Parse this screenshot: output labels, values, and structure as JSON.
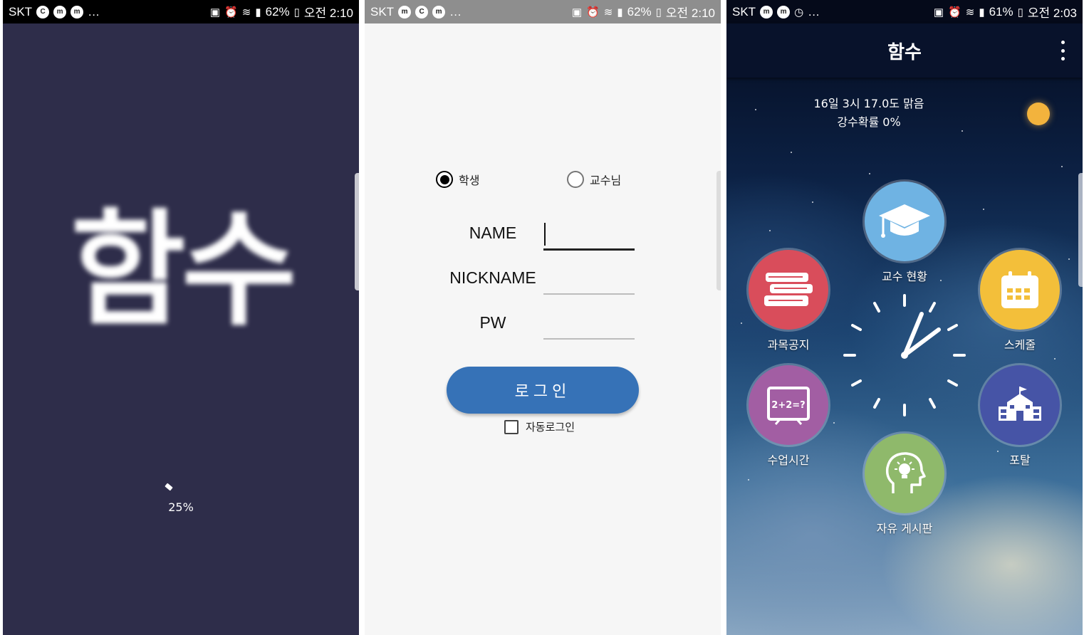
{
  "status_bars": [
    {
      "carrier": "SKT",
      "battery": "62%",
      "time": "오전 2:10"
    },
    {
      "carrier": "SKT",
      "battery": "62%",
      "time": "오전 2:10"
    },
    {
      "carrier": "SKT",
      "battery": "61%",
      "time": "오전 2:03"
    }
  ],
  "splash": {
    "logo_text": "함수",
    "progress_text": "25%",
    "background": "#2e2d4a"
  },
  "login": {
    "role_student": "학생",
    "role_professor": "교수님",
    "selected_role": "학생",
    "name_label": "NAME",
    "nickname_label": "NICKNAME",
    "pw_label": "PW",
    "login_button": "로그인",
    "auto_login_label": "자동로그인",
    "accent": "#3672b7"
  },
  "main": {
    "title": "함수",
    "weather_line1": "16일 3시 17.0도 맑음",
    "weather_line2": "강수확률 0%",
    "menu": {
      "professor_status": {
        "label": "교수 현황",
        "icon": "graduation-cap-icon",
        "color": "#6fb3e3"
      },
      "course_notice": {
        "label": "과목공지",
        "icon": "books-icon",
        "color": "#d94d5b"
      },
      "schedule": {
        "label": "스케줄",
        "icon": "calendar-icon",
        "color": "#f3bf3a"
      },
      "class_time": {
        "label": "수업시간",
        "icon": "chalkboard-icon",
        "color": "#a25ea3"
      },
      "portal": {
        "label": "포탈",
        "icon": "school-building-icon",
        "color": "#4654a6"
      },
      "free_board": {
        "label": "자유 게시판",
        "icon": "head-idea-icon",
        "color": "#8fb96b"
      }
    }
  }
}
